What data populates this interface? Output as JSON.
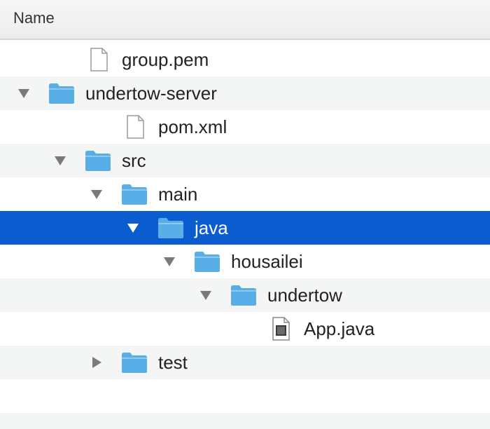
{
  "header": {
    "name_label": "Name"
  },
  "tree": [
    {
      "label": "group.pem",
      "kind": "file",
      "depth": 1,
      "disclosure": "none"
    },
    {
      "label": "undertow-server",
      "kind": "folder",
      "depth": 0,
      "disclosure": "expanded"
    },
    {
      "label": "pom.xml",
      "kind": "file",
      "depth": 2,
      "disclosure": "none"
    },
    {
      "label": "src",
      "kind": "folder",
      "depth": 1,
      "disclosure": "expanded"
    },
    {
      "label": "main",
      "kind": "folder",
      "depth": 2,
      "disclosure": "expanded"
    },
    {
      "label": "java",
      "kind": "folder",
      "depth": 3,
      "disclosure": "expanded",
      "selected": true
    },
    {
      "label": "housailei",
      "kind": "folder",
      "depth": 4,
      "disclosure": "expanded"
    },
    {
      "label": "undertow",
      "kind": "folder",
      "depth": 5,
      "disclosure": "expanded"
    },
    {
      "label": "App.java",
      "kind": "java-file",
      "depth": 6,
      "disclosure": "none"
    },
    {
      "label": "test",
      "kind": "folder",
      "depth": 2,
      "disclosure": "collapsed"
    },
    {
      "label": "",
      "kind": "empty",
      "depth": 0,
      "disclosure": "none"
    },
    {
      "label": "",
      "kind": "empty",
      "depth": 0,
      "disclosure": "none"
    }
  ],
  "colors": {
    "selection": "#0a5ccf",
    "folder": "#5aaee6",
    "stripe": "#f4f5f5"
  }
}
